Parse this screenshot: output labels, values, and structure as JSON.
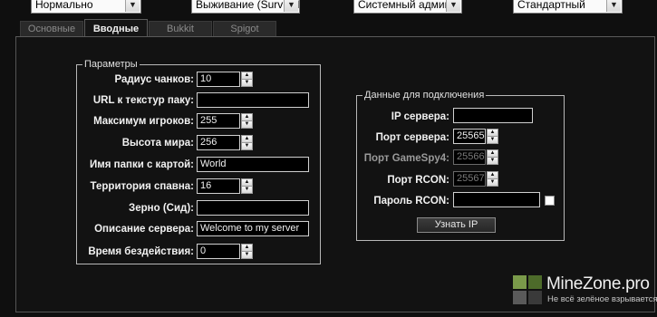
{
  "toolbar": {
    "difficulty": "Нормально",
    "gamemode": "Выживание (Survival",
    "op_level": "Системный админ",
    "world_type": "Стандартный"
  },
  "tabs": [
    {
      "label": "Основные",
      "active": false
    },
    {
      "label": "Вводные",
      "active": true
    },
    {
      "label": "Bukkit",
      "active": false
    },
    {
      "label": "Spigot",
      "active": false
    }
  ],
  "params": {
    "legend": "Параметры",
    "chunk_radius": {
      "label": "Радиус чанков:",
      "value": "10"
    },
    "texture_pack_url": {
      "label": "URL к текстур паку:",
      "value": ""
    },
    "max_players": {
      "label": "Максимум игроков:",
      "value": "255"
    },
    "world_height": {
      "label": "Высота мира:",
      "value": "256"
    },
    "world_folder": {
      "label": "Имя папки с картой:",
      "value": "World"
    },
    "spawn_protection": {
      "label": "Территория спавна:",
      "value": "16"
    },
    "seed": {
      "label": "Зерно (Сид):",
      "value": ""
    },
    "motd": {
      "label": "Описание сервера:",
      "value": "Welcome to my server"
    },
    "idle_timeout": {
      "label": "Время бездействия:",
      "value": "0"
    }
  },
  "connection": {
    "legend": "Данные для подключения",
    "server_ip": {
      "label": "IP сервера:",
      "value": ""
    },
    "server_port": {
      "label": "Порт сервера:",
      "value": "25565"
    },
    "gamespy_port": {
      "label": "Порт GameSpy4:",
      "value": "25566"
    },
    "rcon_port": {
      "label": "Порт RCON:",
      "value": "25567"
    },
    "rcon_password": {
      "label": "Пароль RCON:",
      "value": ""
    },
    "find_ip_button": "Узнать IP"
  },
  "watermark": {
    "title": "MineZone.pro",
    "tagline": "Не всё зелёное взрывается",
    "colors": [
      "#7a9a4a",
      "#4d6b2a",
      "#5a5a5a",
      "#3a3a3a"
    ]
  }
}
